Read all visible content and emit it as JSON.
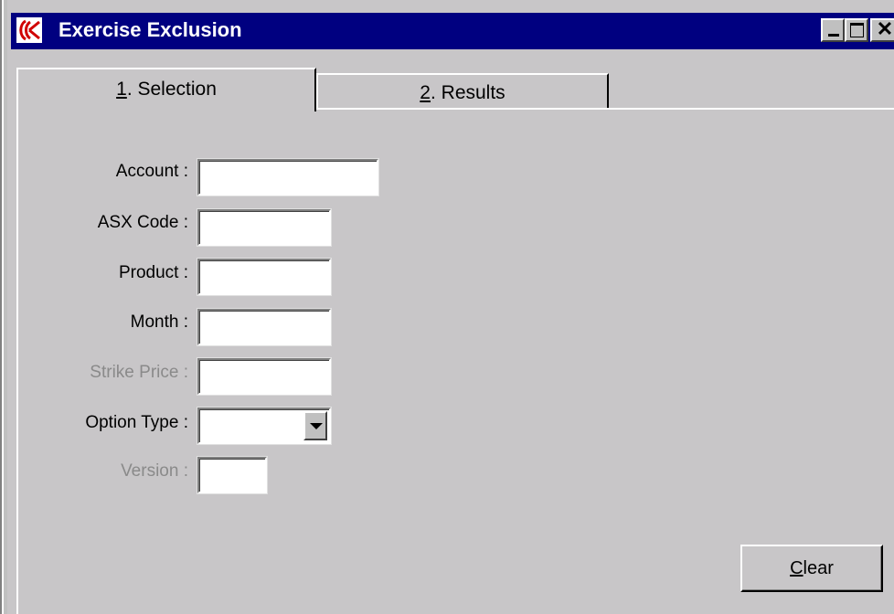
{
  "window": {
    "title": "Exercise Exclusion"
  },
  "tabs": [
    {
      "accel": "1",
      "rest": ". Selection",
      "active": true
    },
    {
      "accel": "2",
      "rest": ". Results",
      "active": false
    }
  ],
  "form": {
    "account_label": "Account :",
    "account_value": "",
    "asx_code_label": "ASX Code :",
    "asx_code_value": "",
    "product_label": "Product :",
    "product_value": "",
    "month_label": "Month :",
    "month_value": "",
    "strike_price_label": "Strike Price :",
    "strike_price_value": "",
    "option_type_label": "Option Type :",
    "option_type_value": "",
    "version_label": "Version :",
    "version_value": ""
  },
  "buttons": {
    "clear_accel": "C",
    "clear_rest": "lear"
  },
  "icons": {
    "app": "app-logo-icon",
    "minimize": "minimize-icon",
    "maximize": "maximize-icon",
    "close": "close-icon",
    "dropdown": "chevron-down-icon"
  },
  "colors": {
    "titlebar": "#000080",
    "face": "#c8c6c8",
    "disabled_text": "#8a8a8a"
  }
}
